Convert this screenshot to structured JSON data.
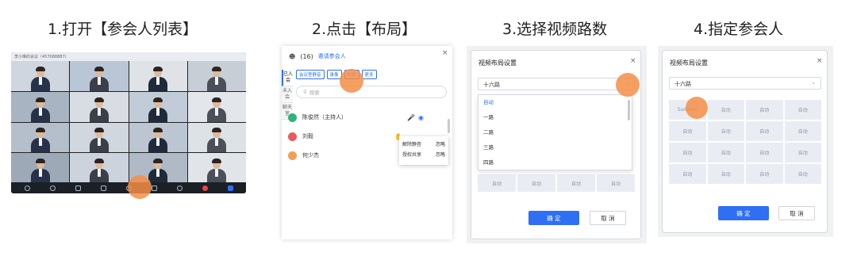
{
  "steps": {
    "s1": "1.打开【参会人列表】",
    "s2": "2.点击【布局】",
    "s3": "3.选择视频路数",
    "s4": "4.指定参会人"
  },
  "meeting": {
    "title": "李小琳的会议（457088887）"
  },
  "participants_panel": {
    "count": "(16)",
    "invite": "邀请参会人",
    "close": "×",
    "side_tabs": [
      "已入会",
      "未入会",
      "聊天室"
    ],
    "chips": [
      "会议室静音",
      "录像",
      "布局",
      "更多"
    ],
    "search_placeholder": "搜索",
    "search_icon": "search-icon",
    "people": [
      {
        "name": "陈俊然（主持人）",
        "color": "#2fb37a"
      },
      {
        "name": "刘毅",
        "color": "#ea5a5a"
      },
      {
        "name": "何少杰",
        "color": "#f0a050"
      }
    ],
    "popup": {
      "row1_left": "解除静音",
      "row1_right": "忽略",
      "row2_left": "授权共享",
      "row2_right": "忽略"
    }
  },
  "layout_dialog_step3": {
    "title": "视频布局设置",
    "close": "×",
    "selected": "十六路",
    "options": [
      "自动",
      "一路",
      "二路",
      "三路",
      "四路"
    ],
    "cell_label": "自动",
    "confirm": "确 定",
    "cancel": "取 消"
  },
  "layout_dialog_step4": {
    "title": "视频布局设置",
    "close": "×",
    "selected": "十六路",
    "first_cell": "Summer",
    "cell_label": "自动",
    "confirm": "确 定",
    "cancel": "取 消"
  },
  "colors": {
    "accent": "#2f6ff3",
    "highlight": "#f58e48"
  }
}
